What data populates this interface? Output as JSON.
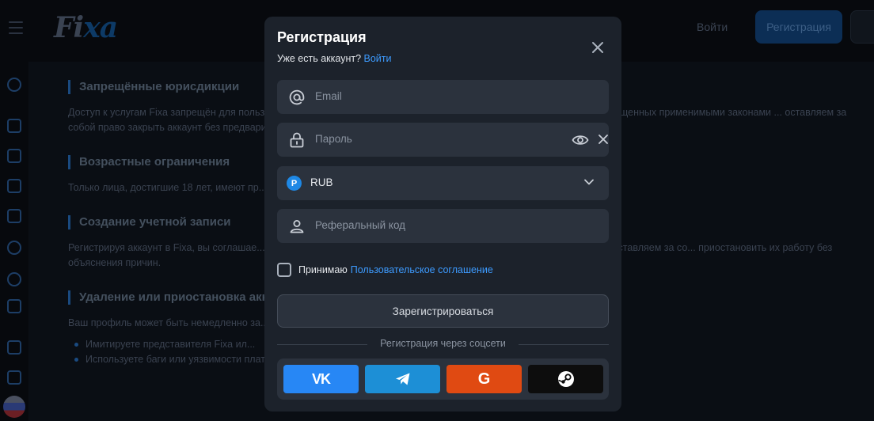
{
  "header": {
    "logo_main": "Fi",
    "logo_accent": "xa",
    "login_label": "Войти",
    "register_label": "Регистрация"
  },
  "background": {
    "sections": [
      {
        "heading": "Запрещённые юрисдикции",
        "text": "Доступ к услугам Fixa запрещён для пользователей из ... Судана, Сирии, Ирана, Северной Кореи и других стран, запрещенных применимыми законами ... оставляем за собой право закрыть аккаунт без предварительного уведомления. Подроб..."
      },
      {
        "heading": "Возрастные ограничения",
        "text": "Только лица, достигшие 18 лет, имеют пр... подтверждаете своё совершеннолетие."
      },
      {
        "heading": "Создание учетной записи",
        "text": "Регистрируя аккаунт в Fixa, вы соглашае... ность за все действия в рамках вашего профиля лежит только на вас. Мы оставляем за со... приостановить их работу без объяснения причин."
      },
      {
        "heading": "Удаление или приостановка акк...",
        "text": "Ваш профиль может быть немедленно за..."
      }
    ],
    "bullets": [
      "Имитируете представителя Fixa ил...",
      "Используете баги или уязвимости платформы"
    ]
  },
  "modal": {
    "title": "Регистрация",
    "subtitle_text": "Уже есть аккаунт?",
    "subtitle_link": "Войти",
    "email_placeholder": "Email",
    "password_placeholder": "Пароль",
    "currency_badge": "Р",
    "currency_value": "RUB",
    "referral_placeholder": "Реферальный код",
    "agree_text": "Принимаю",
    "agree_link": "Пользовательское соглашение",
    "submit_label": "Зарегистрироваться",
    "social_divider": "Регистрация через соцсети",
    "social": [
      {
        "name": "vk",
        "label": "VK",
        "color": "#2787f5"
      },
      {
        "name": "telegram",
        "icon": "telegram-icon",
        "color": "#1d8fd6"
      },
      {
        "name": "google",
        "label": "G",
        "color": "#e04a12"
      },
      {
        "name": "steam",
        "icon": "steam-icon",
        "color": "#0d0d0d"
      }
    ]
  },
  "colors": {
    "accent": "#3d9bff",
    "modal_bg": "#1c222b",
    "field_bg": "#2b323d"
  }
}
